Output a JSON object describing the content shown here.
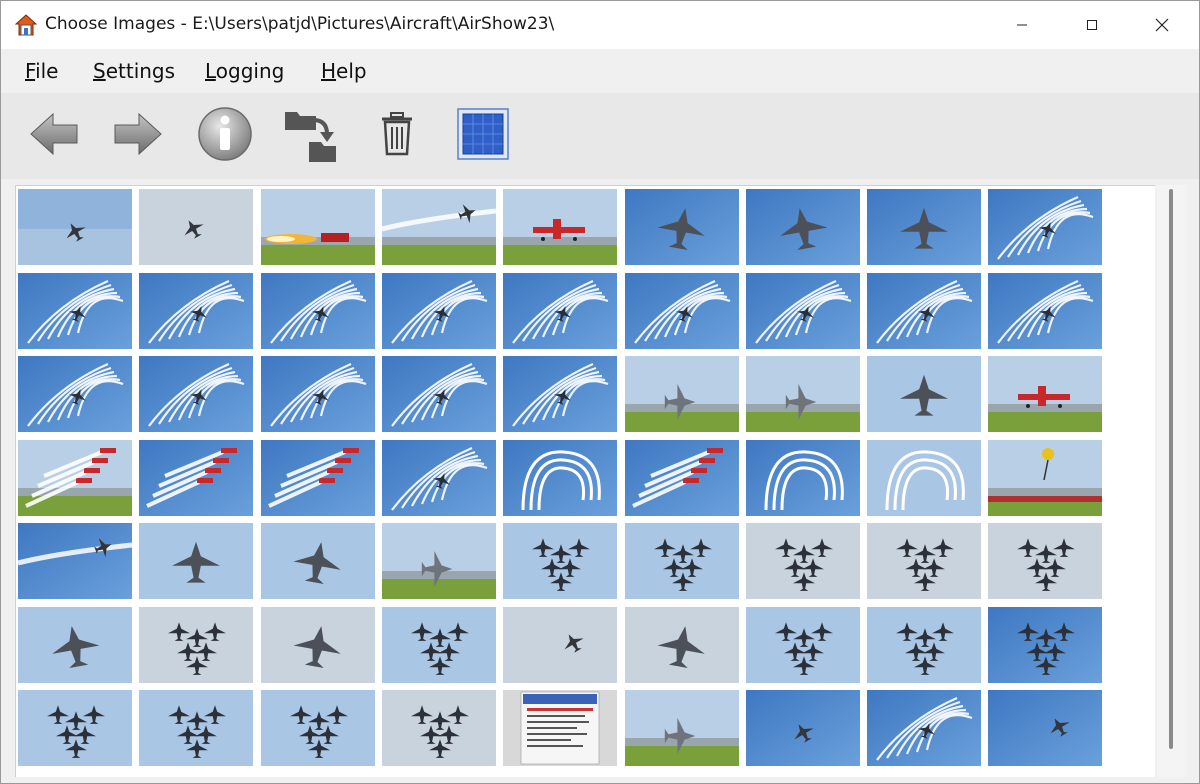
{
  "window": {
    "title": "Choose Images - E:\\Users\\patjd\\Pictures\\Aircraft\\AirShow23\\",
    "icon": "app-home-icon"
  },
  "menu": [
    {
      "label": "File",
      "accel": "F"
    },
    {
      "label": "Settings",
      "accel": "S"
    },
    {
      "label": "Logging",
      "accel": "L"
    },
    {
      "label": "Help",
      "accel": "H"
    }
  ],
  "toolbar": [
    {
      "name": "back-arrow-icon"
    },
    {
      "name": "forward-arrow-icon"
    },
    {
      "name": "info-icon"
    },
    {
      "name": "move-folder-icon"
    },
    {
      "name": "trash-icon"
    },
    {
      "name": "grid-view-icon"
    }
  ],
  "colors": {
    "sky_blue": "#4f86c6",
    "sky_pale": "#a9c6e4",
    "sky_haze": "#c9d3dd",
    "grass": "#7aa03c",
    "selection": "#2f5fc8"
  },
  "thumbnails": [
    {
      "row": 0,
      "col": 0,
      "scene": "sky-light",
      "subject": "jet-small"
    },
    {
      "row": 0,
      "col": 1,
      "scene": "sky-haze",
      "subject": "jet-small"
    },
    {
      "row": 0,
      "col": 2,
      "scene": "runway",
      "subject": "fire-car"
    },
    {
      "row": 0,
      "col": 3,
      "scene": "runway",
      "subject": "smoke-line"
    },
    {
      "row": 0,
      "col": 4,
      "scene": "runway",
      "subject": "red-plane"
    },
    {
      "row": 0,
      "col": 5,
      "scene": "sky-blue",
      "subject": "jet-large"
    },
    {
      "row": 0,
      "col": 6,
      "scene": "sky-blue",
      "subject": "jet-large"
    },
    {
      "row": 0,
      "col": 7,
      "scene": "sky-blue",
      "subject": "jet-large"
    },
    {
      "row": 0,
      "col": 8,
      "scene": "sky-blue",
      "subject": "contrails"
    },
    {
      "row": 1,
      "col": 0,
      "scene": "sky-blue",
      "subject": "contrails"
    },
    {
      "row": 1,
      "col": 1,
      "scene": "sky-blue",
      "subject": "contrails"
    },
    {
      "row": 1,
      "col": 2,
      "scene": "sky-blue",
      "subject": "contrails"
    },
    {
      "row": 1,
      "col": 3,
      "scene": "sky-blue",
      "subject": "contrails"
    },
    {
      "row": 1,
      "col": 4,
      "scene": "sky-blue",
      "subject": "contrails"
    },
    {
      "row": 1,
      "col": 5,
      "scene": "sky-blue",
      "subject": "contrails"
    },
    {
      "row": 1,
      "col": 6,
      "scene": "sky-blue",
      "subject": "contrails"
    },
    {
      "row": 1,
      "col": 7,
      "scene": "sky-blue",
      "subject": "contrails"
    },
    {
      "row": 1,
      "col": 8,
      "scene": "sky-blue",
      "subject": "contrails"
    },
    {
      "row": 2,
      "col": 0,
      "scene": "sky-blue",
      "subject": "contrails"
    },
    {
      "row": 2,
      "col": 1,
      "scene": "sky-blue",
      "subject": "contrails"
    },
    {
      "row": 2,
      "col": 2,
      "scene": "sky-blue",
      "subject": "contrails"
    },
    {
      "row": 2,
      "col": 3,
      "scene": "sky-blue",
      "subject": "contrails"
    },
    {
      "row": 2,
      "col": 4,
      "scene": "sky-blue",
      "subject": "contrails"
    },
    {
      "row": 2,
      "col": 5,
      "scene": "runway",
      "subject": "jet-ground"
    },
    {
      "row": 2,
      "col": 6,
      "scene": "runway",
      "subject": "jet-ground"
    },
    {
      "row": 2,
      "col": 7,
      "scene": "sky-pale",
      "subject": "jet-large"
    },
    {
      "row": 2,
      "col": 8,
      "scene": "runway",
      "subject": "red-plane"
    },
    {
      "row": 3,
      "col": 0,
      "scene": "runway",
      "subject": "red-formation"
    },
    {
      "row": 3,
      "col": 1,
      "scene": "sky-blue",
      "subject": "red-formation"
    },
    {
      "row": 3,
      "col": 2,
      "scene": "sky-blue",
      "subject": "red-formation"
    },
    {
      "row": 3,
      "col": 3,
      "scene": "sky-blue",
      "subject": "contrails"
    },
    {
      "row": 3,
      "col": 4,
      "scene": "sky-blue",
      "subject": "loop"
    },
    {
      "row": 3,
      "col": 5,
      "scene": "sky-blue",
      "subject": "red-formation"
    },
    {
      "row": 3,
      "col": 6,
      "scene": "sky-blue",
      "subject": "loop"
    },
    {
      "row": 3,
      "col": 7,
      "scene": "sky-pale",
      "subject": "loop"
    },
    {
      "row": 3,
      "col": 8,
      "scene": "runway",
      "subject": "crowd"
    },
    {
      "row": 4,
      "col": 0,
      "scene": "sky-blue",
      "subject": "smoke-line"
    },
    {
      "row": 4,
      "col": 1,
      "scene": "sky-pale",
      "subject": "jet-large"
    },
    {
      "row": 4,
      "col": 2,
      "scene": "sky-pale",
      "subject": "jet-large"
    },
    {
      "row": 4,
      "col": 3,
      "scene": "runway",
      "subject": "jet-ground"
    },
    {
      "row": 4,
      "col": 4,
      "scene": "sky-pale",
      "subject": "formation"
    },
    {
      "row": 4,
      "col": 5,
      "scene": "sky-pale",
      "subject": "formation"
    },
    {
      "row": 4,
      "col": 6,
      "scene": "sky-haze",
      "subject": "formation"
    },
    {
      "row": 4,
      "col": 7,
      "scene": "sky-haze",
      "subject": "formation"
    },
    {
      "row": 4,
      "col": 8,
      "scene": "sky-haze",
      "subject": "formation"
    },
    {
      "row": 5,
      "col": 0,
      "scene": "sky-pale",
      "subject": "jet-large"
    },
    {
      "row": 5,
      "col": 1,
      "scene": "sky-haze",
      "subject": "formation"
    },
    {
      "row": 5,
      "col": 2,
      "scene": "sky-haze",
      "subject": "jet-large"
    },
    {
      "row": 5,
      "col": 3,
      "scene": "sky-pale",
      "subject": "formation"
    },
    {
      "row": 5,
      "col": 4,
      "scene": "sky-haze",
      "subject": "jet-small"
    },
    {
      "row": 5,
      "col": 5,
      "scene": "sky-haze",
      "subject": "jet-large"
    },
    {
      "row": 5,
      "col": 6,
      "scene": "sky-pale",
      "subject": "formation"
    },
    {
      "row": 5,
      "col": 7,
      "scene": "sky-pale",
      "subject": "formation"
    },
    {
      "row": 5,
      "col": 8,
      "scene": "sky-blue",
      "subject": "formation"
    },
    {
      "row": 6,
      "col": 0,
      "scene": "sky-pale",
      "subject": "formation"
    },
    {
      "row": 6,
      "col": 1,
      "scene": "sky-pale",
      "subject": "formation"
    },
    {
      "row": 6,
      "col": 2,
      "scene": "sky-pale",
      "subject": "formation"
    },
    {
      "row": 6,
      "col": 3,
      "scene": "sky-haze",
      "subject": "formation"
    },
    {
      "row": 6,
      "col": 4,
      "scene": "poster",
      "subject": "poster"
    },
    {
      "row": 6,
      "col": 5,
      "scene": "runway",
      "subject": "jet-ground"
    },
    {
      "row": 6,
      "col": 6,
      "scene": "sky-blue",
      "subject": "jet-small"
    },
    {
      "row": 6,
      "col": 7,
      "scene": "sky-blue",
      "subject": "contrails"
    },
    {
      "row": 6,
      "col": 8,
      "scene": "sky-blue",
      "subject": "jet-small"
    }
  ]
}
